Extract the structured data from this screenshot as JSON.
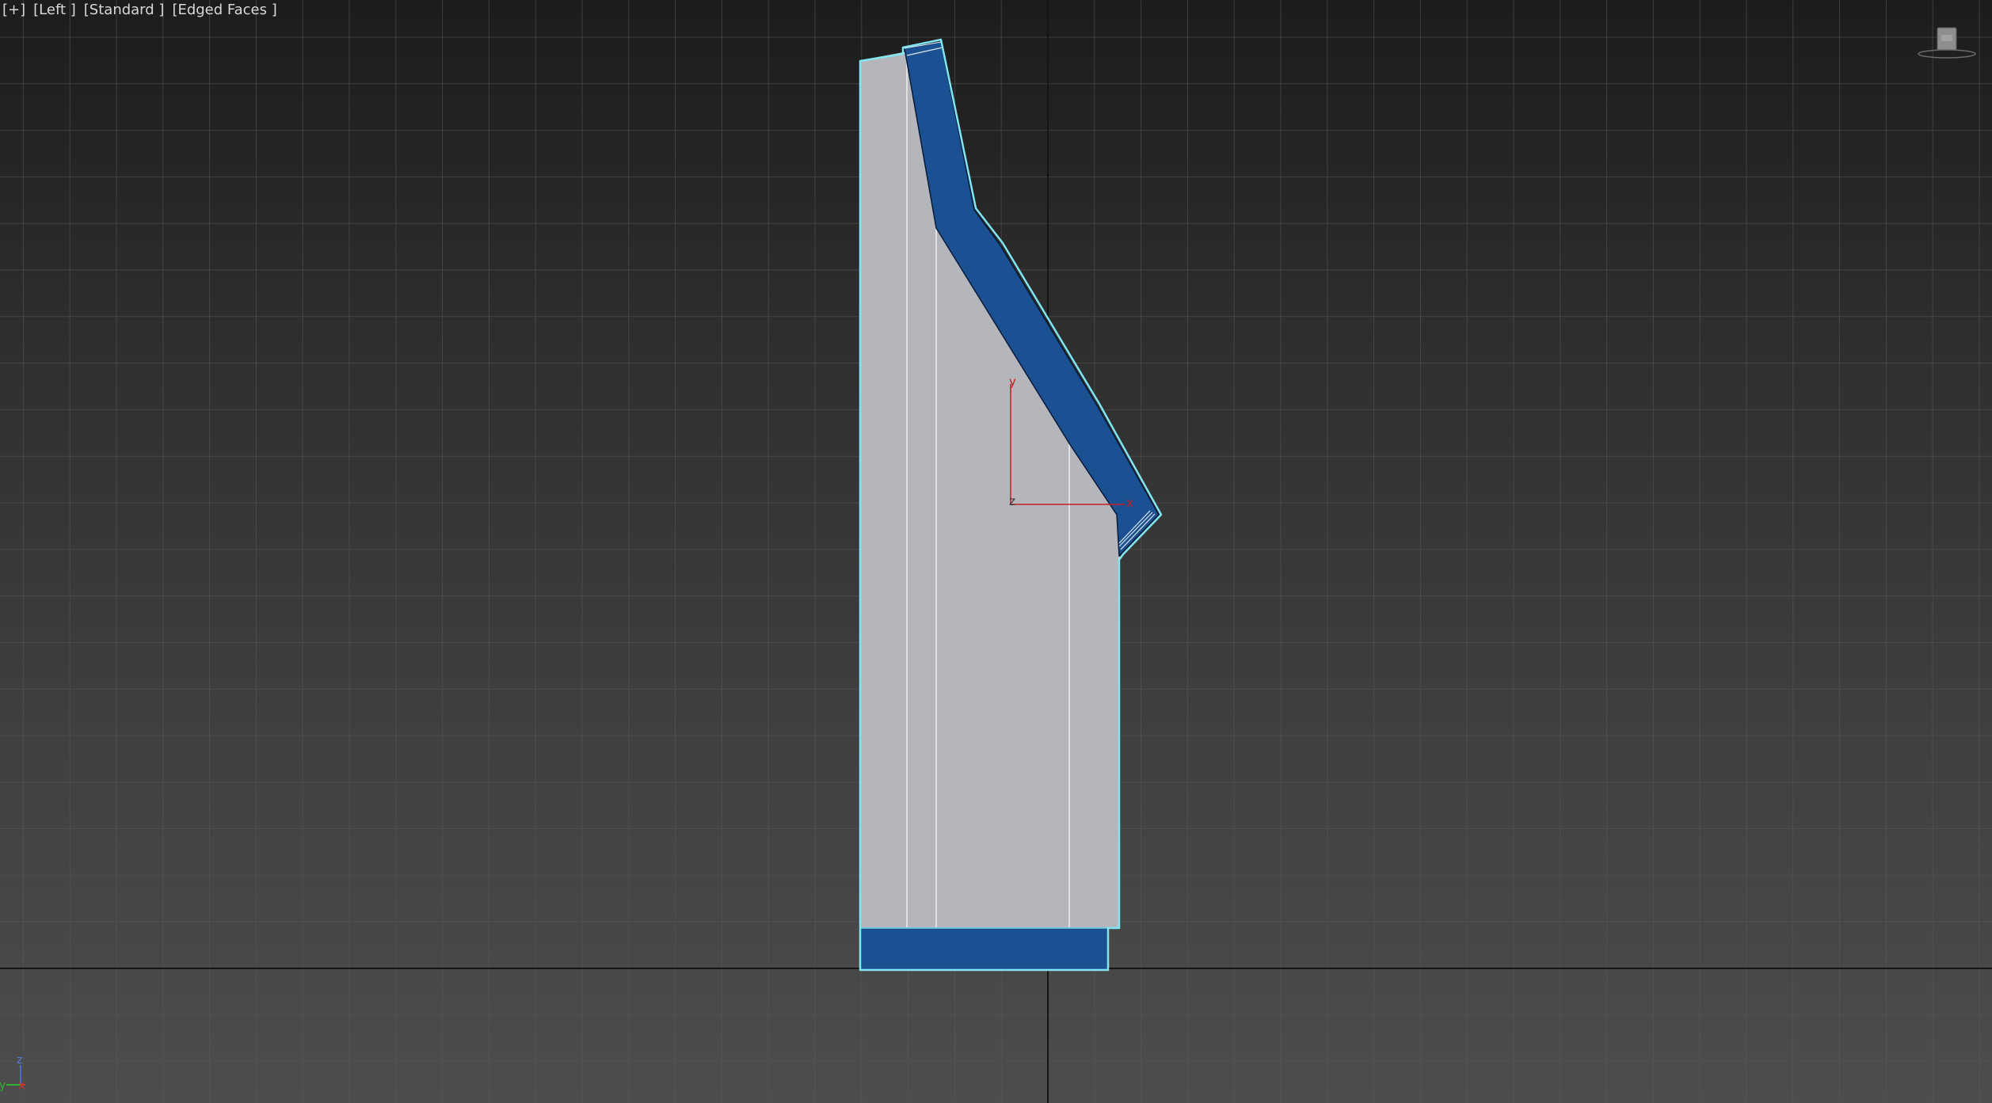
{
  "viewport": {
    "menu_label": "[+]",
    "view_label": "[Left ]",
    "style_label": "[Standard ]",
    "shading_label": "[Edged Faces ]"
  },
  "gizmo": {
    "y_label": "y",
    "z_label": "z",
    "x_label": "x"
  },
  "world_axis": {
    "z_label": "z",
    "y_label": "y",
    "x_label": "x"
  },
  "colors": {
    "selection_outline": "#7fe6f2",
    "body_fill": "#b5b6bb",
    "accent_blue": "#1b5192",
    "gizmo_red": "#c02020",
    "grid_line": "#5a5a5a",
    "world_axis_line": "#151515"
  },
  "icons": {
    "viewcube": "viewcube-icon"
  }
}
